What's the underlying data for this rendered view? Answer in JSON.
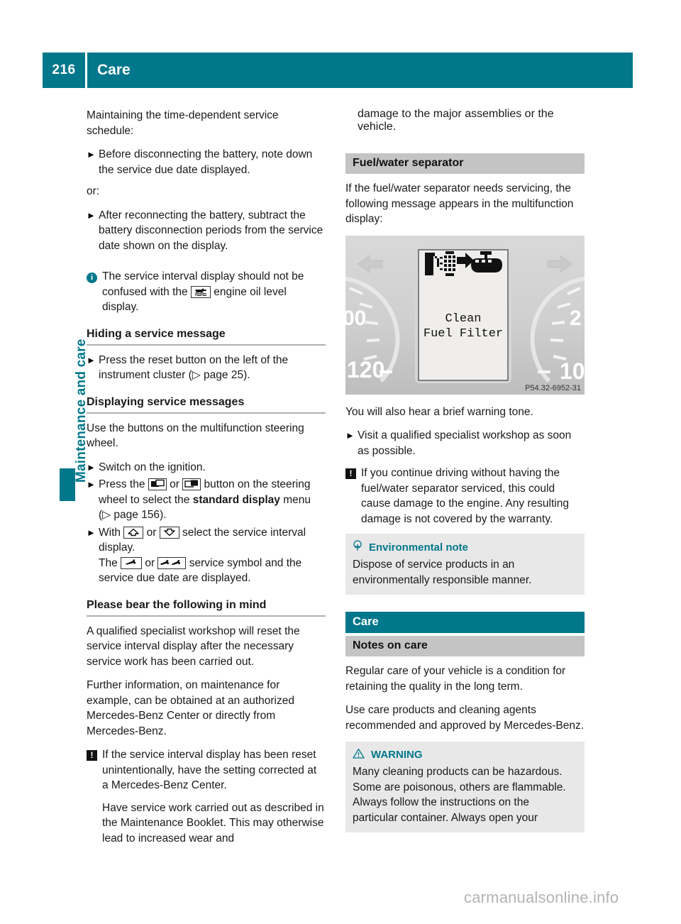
{
  "header": {
    "page_number": "216",
    "title": "Care"
  },
  "side_tab": {
    "label": "Maintenance and care"
  },
  "left_column": {
    "intro": "Maintaining the time-dependent service schedule:",
    "bullet_1": "Before disconnecting the battery, note down the service due date displayed.",
    "or_label": "or:",
    "bullet_2": "After reconnecting the battery, subtract the battery disconnection periods from the service date shown on the display.",
    "info_note_part1": "The service interval display should not be confused with the",
    "info_note_part2": "engine oil level display.",
    "heading_hiding": "Hiding a service message",
    "hiding_bullet": "Press the reset button on the left of the instrument cluster (",
    "hiding_bullet_ref": "page 25",
    "hiding_bullet_end": ").",
    "heading_displaying": "Displaying service messages",
    "displaying_intro": "Use the buttons on the multifunction steering wheel.",
    "bullet_ignition": "Switch on the ignition.",
    "bullet_press_a": "Press the",
    "bullet_press_or": "or",
    "bullet_press_b": "button on the steering wheel to select the",
    "bullet_press_bold": "standard display",
    "bullet_press_c": "menu (",
    "bullet_press_ref": "page 156",
    "bullet_press_end": ").",
    "bullet_with_a": "With",
    "bullet_with_or": "or",
    "bullet_with_b": "select the service interval display.",
    "bullet_with_c": "The",
    "bullet_with_or2": "or",
    "bullet_with_d": "service symbol and the service due date are displayed.",
    "heading_bear": "Please bear the following in mind",
    "para_qualified": "A qualified specialist workshop will reset the service interval display after the necessary service work has been carried out.",
    "para_further": "Further information, on maintenance for example, can be obtained at an authorized Mercedes-Benz Center or directly from Mercedes-Benz.",
    "warn_note_1": "If the service interval display has been reset unintentionally, have the setting corrected at a Mercedes-Benz Center.",
    "warn_note_2": "Have service work carried out as described in the Maintenance Booklet. This may otherwise lead to increased wear and"
  },
  "right_column": {
    "continued_text": "damage to the major assemblies or the vehicle.",
    "section_fuel_water": "Fuel/water separator",
    "para_if_fuel": "If the fuel/water separator needs servicing, the following message appears in the multifunction display:",
    "figure": {
      "display_line_1": "Clean",
      "display_line_2": "Fuel Filter",
      "gauge_label_left_top": "00",
      "gauge_label_left_bottom": "120",
      "gauge_label_right_top": "2",
      "gauge_label_right_bottom": "10",
      "caption": "P54.32-6952-31"
    },
    "para_warning_tone": "You will also hear a brief warning tone.",
    "bullet_visit": "Visit a qualified specialist workshop as soon as possible.",
    "warn_note_continue": "If you continue driving without having the fuel/water separator serviced, this could cause damage to the engine. Any resulting damage is not covered by the warranty.",
    "env_note": {
      "title": "Environmental note",
      "body": "Dispose of service products in an environmentally responsible manner."
    },
    "chapter_band": "Care",
    "section_notes_on_care": "Notes on care",
    "para_regular_care": "Regular care of your vehicle is a condition for retaining the quality in the long term.",
    "para_use_care": "Use care products and cleaning agents recommended and approved by Mercedes-Benz.",
    "warning_box": {
      "title": "WARNING",
      "body": "Many cleaning products can be hazardous. Some are poisonous, others are flammable. Always follow the instructions on the particular container. Always open your"
    }
  },
  "watermark": "carmanualsonline.info",
  "colors": {
    "teal": "#00778a",
    "band_grey": "#c4c4c4",
    "note_grey": "#e8e8e8",
    "rule_grey": "#b0b0b0"
  }
}
